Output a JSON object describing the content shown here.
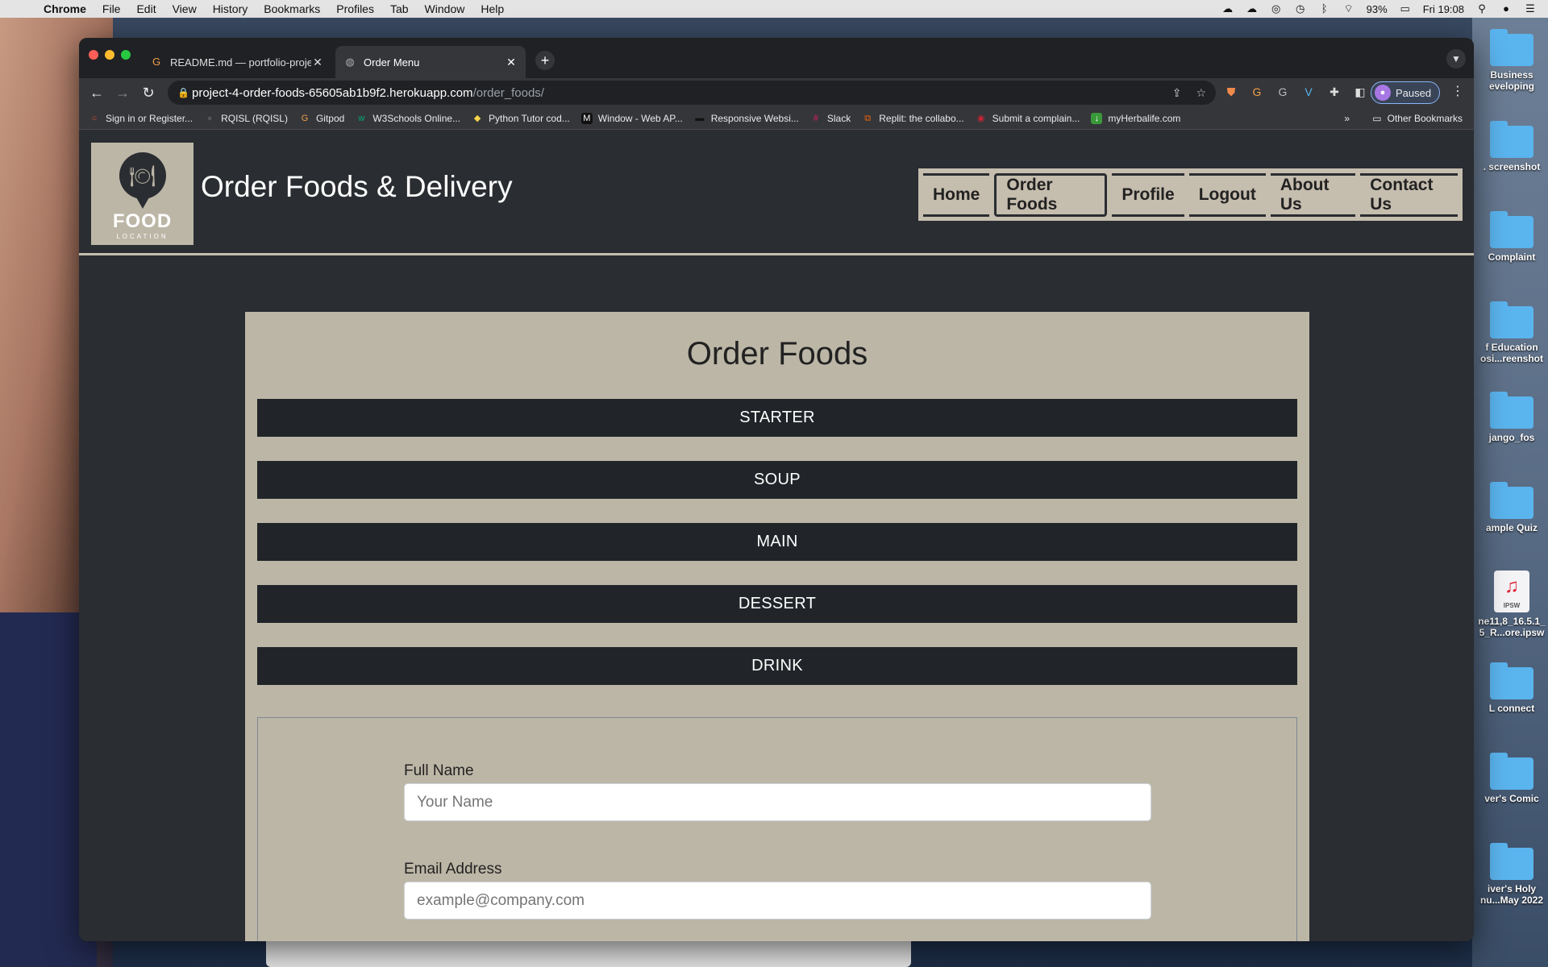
{
  "menubar": {
    "items": [
      "Chrome",
      "File",
      "Edit",
      "View",
      "History",
      "Bookmarks",
      "Profiles",
      "Tab",
      "Window",
      "Help"
    ],
    "battery": "93%",
    "clock": "Fri 19:08"
  },
  "desktop": {
    "icons": [
      {
        "label": "Business\neveloping",
        "type": "folder"
      },
      {
        "label": ". screenshot",
        "type": "folder"
      },
      {
        "label": "Complaint",
        "type": "folder"
      },
      {
        "label": "f Education\nosi...reenshot",
        "type": "folder"
      },
      {
        "label": "jango_fos",
        "type": "folder"
      },
      {
        "label": "ample Quiz",
        "type": "folder"
      },
      {
        "label": "ne11,8_16.5.1_\n5_R...ore.ipsw",
        "type": "ipsw",
        "badge": "IPSW"
      },
      {
        "label": "L connect",
        "type": "folder"
      },
      {
        "label": "ver's Comic",
        "type": "folder"
      },
      {
        "label": "iver's Holy\nnu...May 2022",
        "type": "folder"
      }
    ]
  },
  "browser": {
    "tabs": [
      {
        "title": "README.md — portfolio-proje"
      },
      {
        "title": "Order Menu"
      }
    ],
    "url_host": "project-4-order-foods-65605ab1b9f2.herokuapp.com",
    "url_path": "/order_foods/",
    "profile_label": "Paused",
    "bookmarks": [
      "Sign in or Register...",
      "RQISL (RQISL)",
      "Gitpod",
      "W3Schools Online...",
      "Python Tutor cod...",
      "Window - Web AP...",
      "Responsive Websi...",
      "Slack",
      "Replit: the collabo...",
      "Submit a complain...",
      "myHerbalife.com"
    ],
    "other_bookmarks": "Other Bookmarks",
    "more": "»"
  },
  "site": {
    "logo_title": "FOOD",
    "logo_sub": "LOCATION",
    "brand": "Order Foods & Delivery",
    "nav": [
      "Home",
      "Order Foods",
      "Profile",
      "Logout",
      "About Us",
      "Contact Us"
    ],
    "active_nav": "Order Foods"
  },
  "order": {
    "heading": "Order Foods",
    "categories": [
      "STARTER",
      "SOUP",
      "MAIN",
      "DESSERT",
      "DRINK"
    ],
    "form": {
      "full_name_label": "Full Name",
      "full_name_placeholder": "Your Name",
      "email_label": "Email Address",
      "email_placeholder": "example@company.com"
    }
  }
}
